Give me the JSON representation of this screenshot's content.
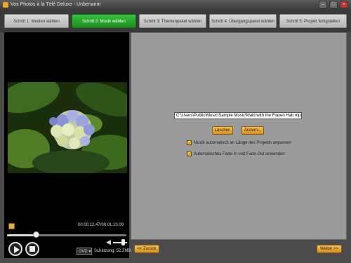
{
  "window": {
    "title": "Vos Photos à la Télé Deluxe - Unbenannt"
  },
  "steps": [
    {
      "label": "Schritt 1: Medien wählen",
      "active": false
    },
    {
      "label": "Schritt 2: Musik wählen",
      "active": true
    },
    {
      "label": "Schritt 3: Themenpaket wählen",
      "active": false
    },
    {
      "label": "Schritt 4: Übergangspaket wählen",
      "active": false
    },
    {
      "label": "Schritt 5: Projekt fertigstellen",
      "active": false
    }
  ],
  "player": {
    "time": "00:00:12.47/00:01:10.09",
    "progress_fraction": 0.24,
    "format_select": "DVD",
    "size_label": "Schätzung: 52,2MB"
  },
  "music": {
    "file_path": "C:\\Users\\Public\\Music\\Sample Music\\Maid with the Flaxen Hair.mp3",
    "delete_label": "Löschen",
    "change_label": "Ändern...",
    "checkbox_fit": "Musik automatisch an Länge des Projekts anpassen",
    "checkbox_fade": "Automatisches Fade-In und Fade-Out anwenden"
  },
  "nav": {
    "back_label": "<< Zurück",
    "next_label": "Weiter >>"
  },
  "colors": {
    "accent_orange": "#e8a523",
    "active_step_green": "#2aa32f"
  }
}
